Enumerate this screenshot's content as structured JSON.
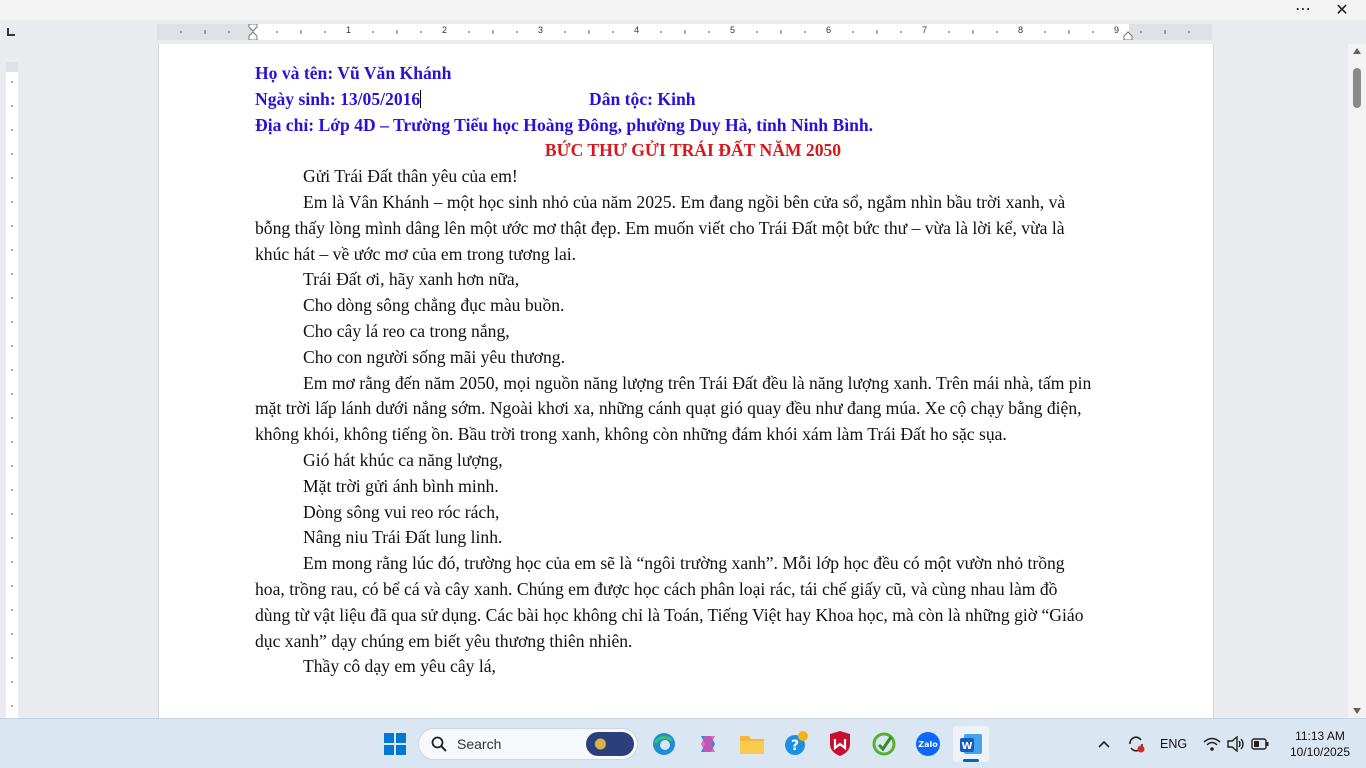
{
  "window": {
    "more_label": "⋯",
    "close_label": "✕"
  },
  "ruler": {
    "numbers": [
      "1",
      "2",
      "3",
      "4",
      "5",
      "6",
      "7",
      "8",
      "9"
    ]
  },
  "document": {
    "header": {
      "name_label": "Họ và tên",
      "name_value": ": Vũ Văn Khánh",
      "dob_label": "Ngày sinh",
      "dob_value": ": 13/05/2016",
      "ethnic_label": "Dân tộc",
      "ethnic_value": ": Kinh",
      "address_label": "Địa chỉ",
      "address_value": ": Lớp 4D – Trường Tiểu học Hoàng Đông, phường Duy Hà, tỉnh Ninh Bình."
    },
    "title": "BỨC THƯ GỬI TRÁI ĐẤT NĂM 2050",
    "greeting": "Gửi Trái Đất thân yêu của em!",
    "para1_line1": "Em là Vân Khánh – một học sinh nhỏ của năm 2025. Em đang ngồi bên cửa sổ, ngắm nhìn bầu trời xanh, và",
    "para1_line2": "bỗng thấy lòng mình dâng lên một ước mơ thật đẹp. Em muốn viết cho Trái Đất một bức thư – vừa là lời kể, vừa là",
    "para1_line3": "khúc hát – về ước mơ của em trong tương lai.",
    "verse1": [
      "Trái Đất ơi, hãy xanh hơn nữa,",
      "Cho dòng sông chẳng đục màu buồn.",
      "Cho cây lá reo ca trong nắng,",
      "Cho con người sống mãi yêu thương."
    ],
    "para2_line1": "Em mơ rằng đến năm 2050, mọi nguồn năng lượng trên Trái Đất đều là năng lượng xanh. Trên mái nhà, tấm pin",
    "para2_line2": "mặt trời lấp lánh dưới nắng sớm. Ngoài khơi xa, những cánh quạt gió quay đều như đang múa. Xe cộ chạy bằng điện,",
    "para2_line3": "không khói, không tiếng ồn. Bầu trời trong xanh, không còn những đám khói xám làm Trái Đất ho sặc sụa.",
    "verse2": [
      "Gió hát khúc ca năng lượng,",
      "Mặt trời gửi ánh bình minh.",
      "Dòng sông vui reo róc rách,",
      "Nâng niu Trái Đất lung linh."
    ],
    "para3_line1": "Em mong rằng lúc đó, trường học của em sẽ là “ngôi trường xanh”. Mỗi lớp học đều có một vườn nhỏ trồng",
    "para3_line2": "hoa, trồng rau, có bể cá và cây xanh. Chúng em được học cách phân loại rác, tái chế giấy cũ, và cùng nhau làm đồ",
    "para3_line3": "dùng từ vật liệu đã qua sử dụng. Các bài học không chỉ là Toán, Tiếng Việt hay Khoa học, mà còn là những giờ “Giáo",
    "para3_line4": "dục xanh” dạy chúng em biết yêu thương thiên nhiên.",
    "verse3_line1": "Thầy cô dạy em yêu cây lá,"
  },
  "taskbar": {
    "search_placeholder": "Search",
    "lang": "ENG",
    "time": "11:13 AM",
    "date": "10/10/2025",
    "zalo_label": "Zalo",
    "word_label": "W",
    "help_label": "?"
  },
  "colors": {
    "header_blue": "#2a10d8",
    "title_red": "#d6181b",
    "word_blue": "#185abd",
    "accent": "#0067c0"
  }
}
